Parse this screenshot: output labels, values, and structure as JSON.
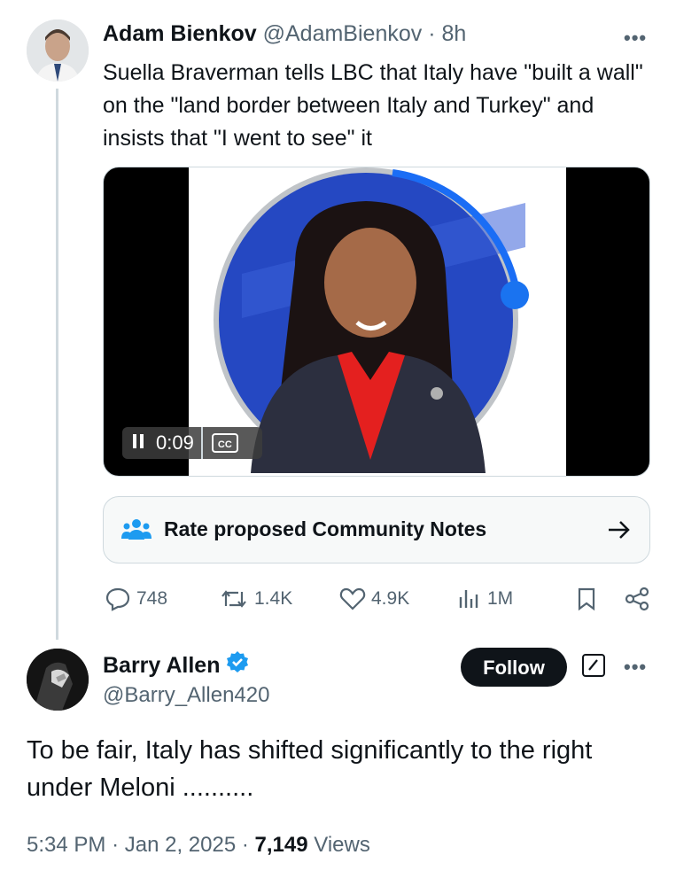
{
  "tweet": {
    "author_name": "Adam Bienkov",
    "author_handle": "@AdamBienkov",
    "separator": "·",
    "time": "8h",
    "text": "Suella Braverman tells LBC that Italy have \"built a wall\" on the \"land border between Italy and Turkey\" and insists that \"I went to see\" it",
    "video": {
      "time": "0:09",
      "cc_label": "CC",
      "progress_fraction": 0.28
    },
    "community_notes_label": "Rate proposed Community Notes",
    "metrics": {
      "replies": "748",
      "reposts": "1.4K",
      "likes": "4.9K",
      "views": "1M"
    }
  },
  "reply": {
    "author_name": "Barry Allen",
    "author_handle": "@Barry_Allen420",
    "follow_label": "Follow",
    "text": "To be fair, Italy has shifted significantly to the right under Meloni ..........",
    "time": "5:34 PM",
    "date": "Jan 2, 2025",
    "views_count": "7,149",
    "views_label": "Views"
  },
  "colors": {
    "accent": "#1d9bf0",
    "verified": "#1d9bf0",
    "muted": "#536471",
    "text": "#0f1419",
    "border": "#cfd9de"
  },
  "icons": [
    "more-icon",
    "pause-icon",
    "cc-icon",
    "people-icon",
    "arrow-right-icon",
    "reply-icon",
    "repost-icon",
    "like-icon",
    "views-icon",
    "bookmark-icon",
    "share-icon",
    "verified-icon",
    "grok-icon"
  ]
}
